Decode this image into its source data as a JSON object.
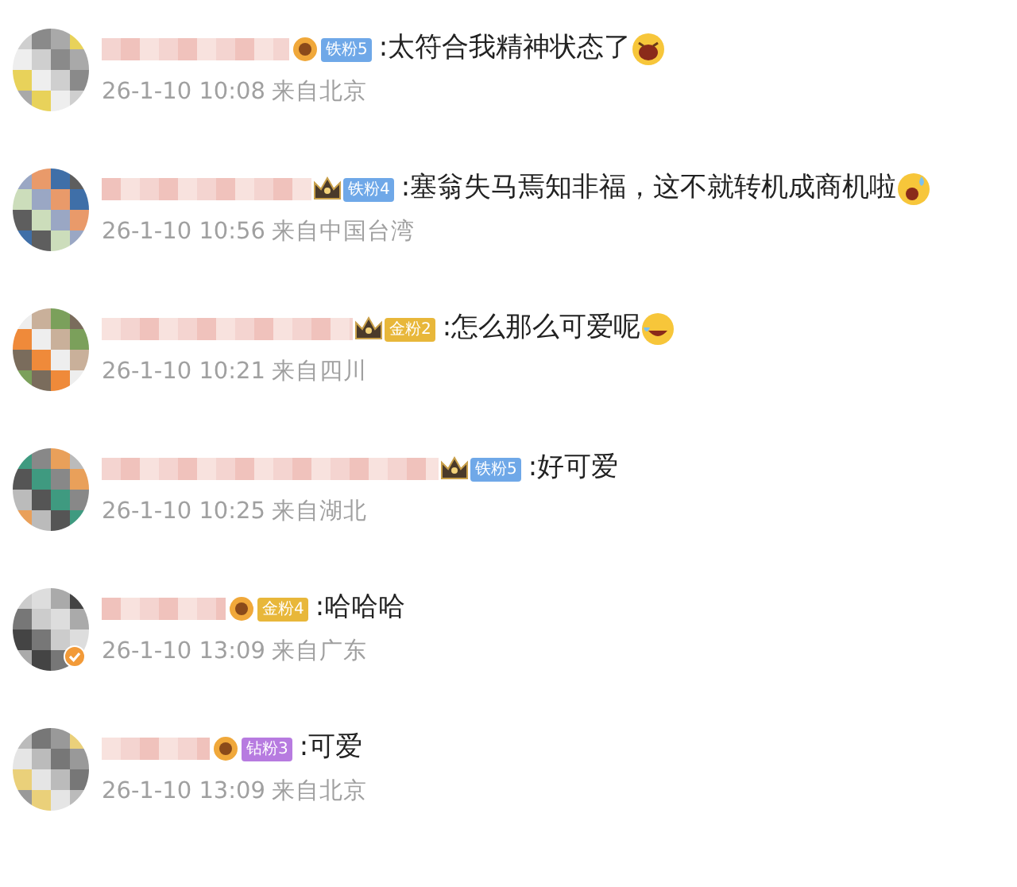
{
  "comments": [
    {
      "verified": false,
      "badge": {
        "kind": "medal",
        "label": "铁粉5",
        "color": "#6fa8e8"
      },
      "text": ":太符合我精神状态了",
      "emoji": {
        "kind": "laugh"
      },
      "time": "26-1-10 10:08",
      "location": "来自北京"
    },
    {
      "verified": false,
      "badge": {
        "kind": "crown",
        "label": "铁粉4",
        "color": "#6fa8e8"
      },
      "text": ":塞翁失马焉知非福，这不就转机成商机啦",
      "emoji": {
        "kind": "sweat"
      },
      "time": "26-1-10 10:56",
      "location": "来自中国台湾"
    },
    {
      "verified": false,
      "badge": {
        "kind": "crown",
        "label": "金粉2",
        "color": "#e8b73a"
      },
      "text": ":怎么那么可爱呢",
      "emoji": {
        "kind": "tears"
      },
      "time": "26-1-10 10:21",
      "location": "来自四川"
    },
    {
      "verified": false,
      "badge": {
        "kind": "crown",
        "label": "铁粉5",
        "color": "#6fa8e8"
      },
      "text": ":好可爱",
      "time": "26-1-10 10:25",
      "location": "来自湖北"
    },
    {
      "verified": true,
      "badge": {
        "kind": "medal",
        "label": "金粉4",
        "color": "#e8b73a"
      },
      "text": ":哈哈哈",
      "time": "26-1-10 13:09",
      "location": "来自广东"
    },
    {
      "verified": false,
      "badge": {
        "kind": "medal",
        "label": "钻粉3",
        "color": "#b77be0"
      },
      "text": ":可爱",
      "time": "26-1-10 13:09",
      "location": "来自北京"
    }
  ]
}
